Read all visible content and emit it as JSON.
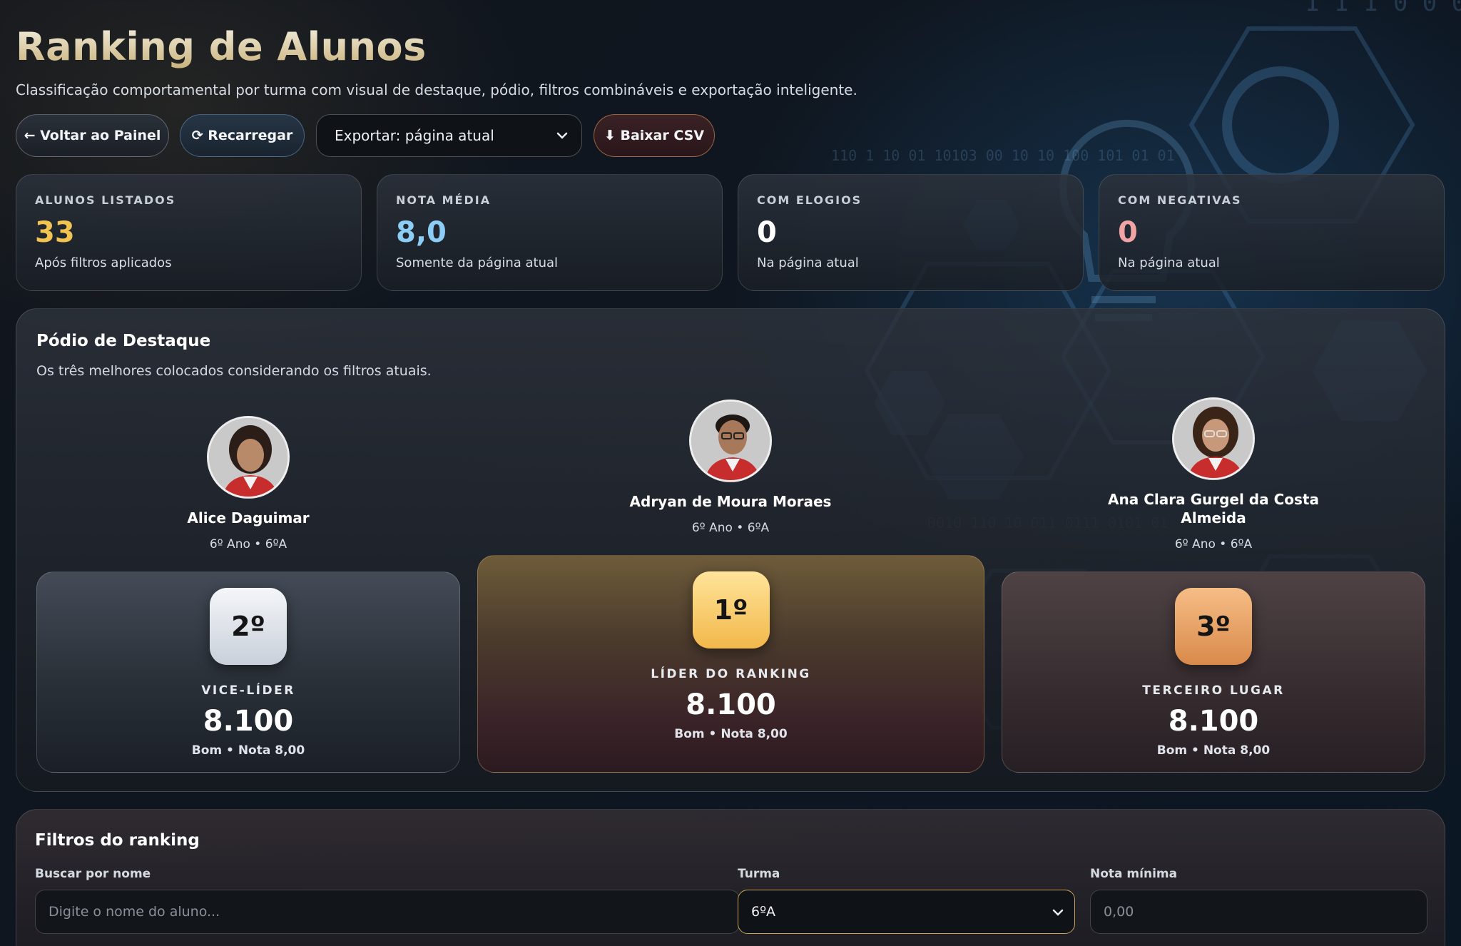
{
  "header": {
    "title": "Ranking de Alunos",
    "subtitle": "Classificação comportamental por turma com visual de destaque, pódio, filtros combináveis e exportação inteligente."
  },
  "toolbar": {
    "back_label": "← Voltar ao Painel",
    "reload_label": "⟳ Recarregar",
    "export_value": "Exportar: página atual",
    "csv_label": "⬇ Baixar CSV"
  },
  "stats": [
    {
      "label": "ALUNOS LISTADOS",
      "value": "33",
      "note": "Após filtros aplicados",
      "color": "#f3c350"
    },
    {
      "label": "NOTA MÉDIA",
      "value": "8,0",
      "note": "Somente da página atual",
      "color": "#8ccdf5"
    },
    {
      "label": "COM ELOGIOS",
      "value": "0",
      "note": "Na página atual",
      "color": "#ffffff"
    },
    {
      "label": "COM NEGATIVAS",
      "value": "0",
      "note": "Na página atual",
      "color": "#f2a4a4"
    }
  ],
  "podium": {
    "title": "Pódio de Destaque",
    "subtitle": "Os três melhores colocados considerando os filtros atuais.",
    "second": {
      "name": "Alice Daguimar",
      "class": "6º Ano • 6ºA",
      "rank": "2º",
      "role": "VICE-LÍDER",
      "points": "8.100",
      "grade": "Bom • Nota 8,00"
    },
    "first": {
      "name": "Adryan de Moura Moraes",
      "class": "6º Ano • 6ºA",
      "rank": "1º",
      "role": "LÍDER DO RANKING",
      "points": "8.100",
      "grade": "Bom • Nota 8,00"
    },
    "third": {
      "name": "Ana Clara Gurgel da Costa Almeida",
      "class": "6º Ano • 6ºA",
      "rank": "3º",
      "role": "TERCEIRO LUGAR",
      "points": "8.100",
      "grade": "Bom • Nota 8,00"
    }
  },
  "filters": {
    "title": "Filtros do ranking",
    "search_label": "Buscar por nome",
    "search_placeholder": "Digite o nome do aluno...",
    "class_label": "Turma",
    "class_value": "6ºA",
    "min_grade_label": "Nota mínima",
    "min_grade_placeholder": "0,00"
  }
}
